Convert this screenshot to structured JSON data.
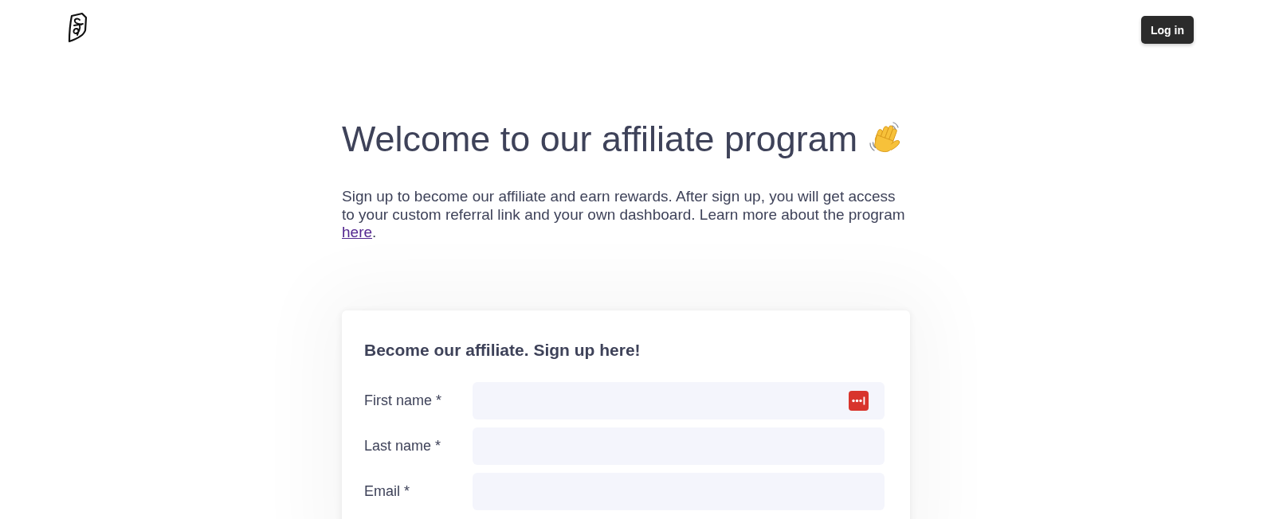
{
  "header": {
    "login_button": "Log in"
  },
  "intro": {
    "heading": "Welcome to our affiliate program",
    "text": "Sign up to become our affiliate and earn rewards. After sign up, you will get access to your custom referral link and your own dashboard. Learn more about the program",
    "link": "here",
    "after_link": "."
  },
  "signup_form": {
    "title": "Become our affiliate. Sign up here!",
    "fields": [
      {
        "label": "First name *",
        "autofill_icon": true
      },
      {
        "label": "Last name *",
        "autofill_icon": false
      },
      {
        "label": "Email *",
        "autofill_icon": false
      }
    ]
  }
}
